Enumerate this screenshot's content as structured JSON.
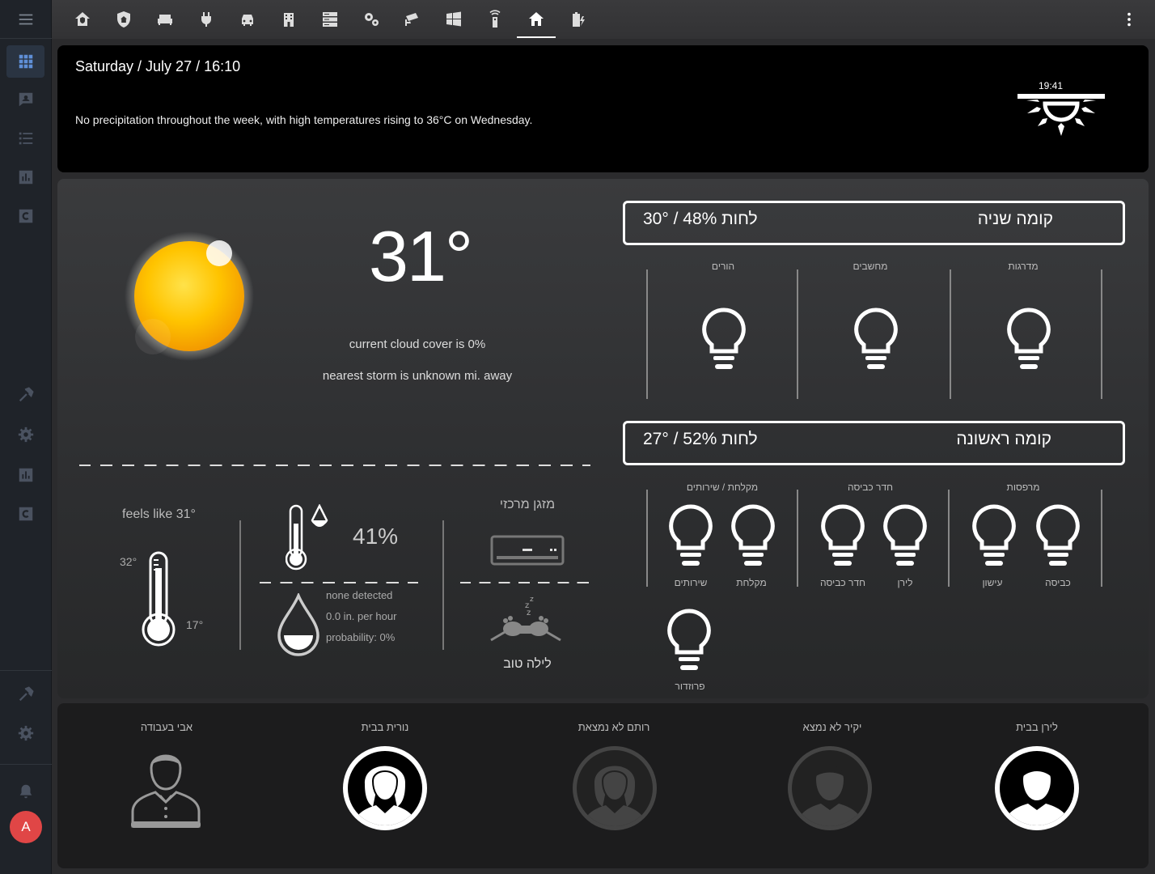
{
  "sidebar": {
    "items": [
      {
        "icon": "grid-icon",
        "active": true
      },
      {
        "icon": "map-icon"
      },
      {
        "icon": "logbook-icon"
      },
      {
        "icon": "history-icon"
      },
      {
        "icon": "hacs-icon"
      },
      {
        "icon": "hammer-icon"
      },
      {
        "icon": "gear-icon"
      },
      {
        "icon": "history-icon"
      },
      {
        "icon": "hacs-icon"
      },
      {
        "icon": "hammer-icon"
      },
      {
        "icon": "gear-icon"
      },
      {
        "icon": "bell-icon"
      }
    ],
    "avatar_initial": "A"
  },
  "toolbar": {
    "tabs": [
      "home-security-icon",
      "shield-home-icon",
      "sofa-icon",
      "power-plug-icon",
      "car-icon",
      "door-building-icon",
      "server-icon",
      "cogs-icon",
      "cctv-icon",
      "windows-icon",
      "remote-icon",
      "home-icon",
      "battery-charging-icon"
    ],
    "active_index": 11
  },
  "header": {
    "date": "Saturday / July 27 / 16:10",
    "forecast": "No precipitation throughout the week, with high temperatures rising to 36°C on Wednesday.",
    "sunset_time": "19:41"
  },
  "weather": {
    "temperature": "31°",
    "cloud_cover": "current cloud cover is 0%",
    "storm": "nearest storm is unknown mi. away",
    "feels_like": "feels like 31°",
    "high": "32°",
    "low": "17°",
    "humidity": "41%",
    "precip_detected": "none detected",
    "precip_rate": "0.0 in. per hour",
    "precip_prob": "probability: 0%",
    "ac_label": "מזגן מרכזי",
    "night_label": "לילה טוב"
  },
  "floors": [
    {
      "name": "קומה שניה",
      "climate": "30° / 48% לחות",
      "rooms": [
        {
          "name": "הורים",
          "lights": [
            ""
          ]
        },
        {
          "name": "מחשבים",
          "lights": [
            ""
          ]
        },
        {
          "name": "מדרגות",
          "lights": [
            ""
          ]
        }
      ]
    },
    {
      "name": "קומה ראשונה",
      "climate": "27° / 52% לחות",
      "rooms": [
        {
          "name": "מקלחת / שירותים",
          "lights": [
            "שירותים",
            "מקלחת"
          ]
        },
        {
          "name": "חדר כביסה",
          "lights": [
            "חדר כביסה",
            "לירן"
          ]
        },
        {
          "name": "מרפסות",
          "lights": [
            "עישון",
            "כביסה"
          ]
        }
      ],
      "extra_light": "פרוזדור"
    }
  ],
  "people": [
    {
      "label": "אבי בעבודה",
      "home": false,
      "style": "outline-man"
    },
    {
      "label": "נורית בבית",
      "home": true,
      "style": "woman"
    },
    {
      "label": "רותם לא נמצאת",
      "home": false,
      "style": "woman"
    },
    {
      "label": "יקיר לא נמצא",
      "home": false,
      "style": "man"
    },
    {
      "label": "לירן בבית",
      "home": true,
      "style": "man"
    }
  ],
  "colors": {
    "background": "#2b2b2d",
    "sidebar": "#1f2329",
    "accent_avatar": "#e04646",
    "sidebar_icon": "#5f8fd6"
  }
}
